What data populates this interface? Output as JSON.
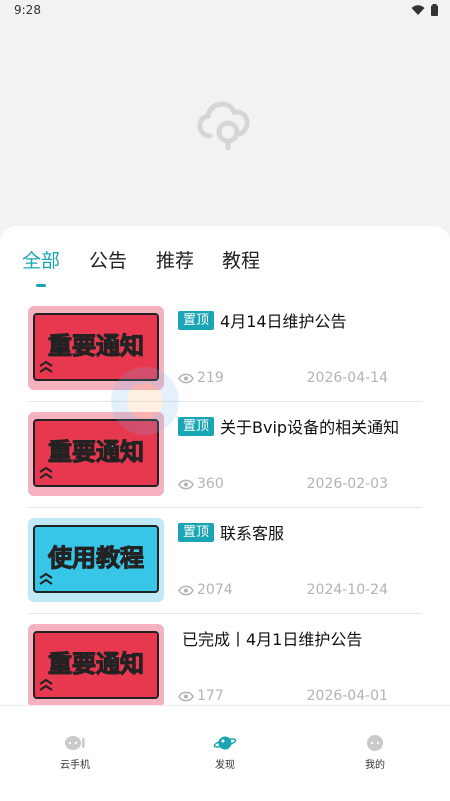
{
  "status_bar": {
    "time": "9:28"
  },
  "tabs": [
    {
      "label": "全部"
    },
    {
      "label": "公告"
    },
    {
      "label": "推荐"
    },
    {
      "label": "教程"
    }
  ],
  "articles": [
    {
      "pinned_label": "置顶",
      "title": "4月14日维护公告",
      "views": "219",
      "date": "2026-04-14",
      "thumb_text": "重要通知",
      "thumb_color": "#e8384f"
    },
    {
      "pinned_label": "置顶",
      "title": "关于Bvip设备的相关通知",
      "views": "360",
      "date": "2026-02-03",
      "thumb_text": "重要通知",
      "thumb_color": "#e8384f"
    },
    {
      "pinned_label": "置顶",
      "title": "联系客服",
      "views": "2074",
      "date": "2024-10-24",
      "thumb_text": "使用教程",
      "thumb_color": "#37c6e8"
    },
    {
      "pinned_label": "",
      "title": "已完成丨4月1日维护公告",
      "views": "177",
      "date": "2026-04-01",
      "thumb_text": "重要通知",
      "thumb_color": "#e8384f"
    }
  ],
  "bottom_nav": [
    {
      "label": "云手机",
      "icon": "cloud-phone-icon"
    },
    {
      "label": "发现",
      "icon": "planet-icon",
      "active": true
    },
    {
      "label": "我的",
      "icon": "profile-icon"
    }
  ],
  "colors": {
    "accent": "#19a5b3"
  }
}
